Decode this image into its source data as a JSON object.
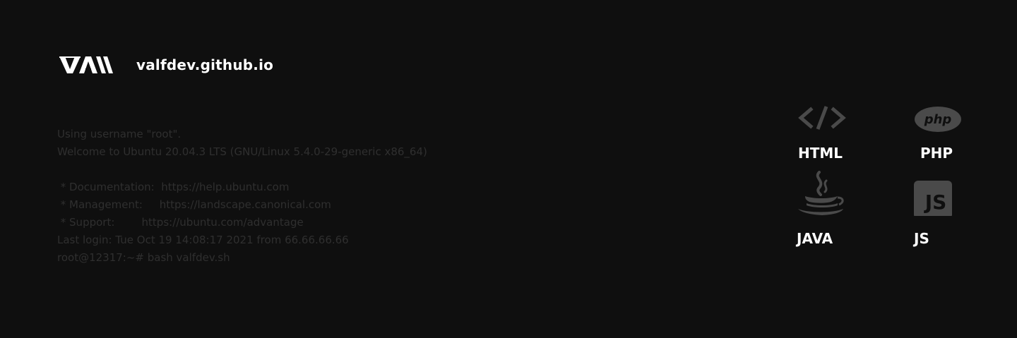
{
  "header": {
    "logo_icon": "valf-logo",
    "title": "valfdev.github.io"
  },
  "terminal": {
    "lines": [
      "Using username \"root\".",
      "Welcome to Ubuntu 20.04.3 LTS (GNU/Linux 5.4.0-29-generic x86_64)",
      "",
      " * Documentation:  https://help.ubuntu.com",
      " * Management:     https://landscape.canonical.com",
      " * Support:        https://ubuntu.com/advantage",
      "Last login: Tue Oct 19 14:08:17 2021 from 66.66.66.66",
      "root@12317:~# bash valfdev.sh"
    ]
  },
  "skills": [
    {
      "label": "HTML",
      "icon": "code-brackets-icon"
    },
    {
      "label": "PHP",
      "icon": "php-icon"
    },
    {
      "label": "JAVA",
      "icon": "java-cup-icon"
    },
    {
      "label": "JS",
      "icon": "js-icon"
    }
  ],
  "colors": {
    "background": "#0f0f0f",
    "text_primary": "#ffffff",
    "terminal_text": "#2f2f2f",
    "icon_gray": "#4a4a4a"
  }
}
